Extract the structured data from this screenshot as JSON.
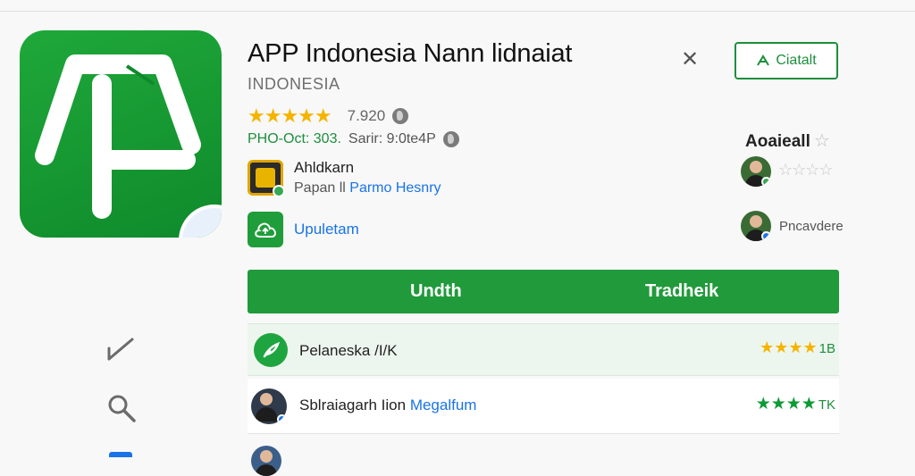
{
  "app": {
    "title": "APP Indonesia Nann lidnaiat",
    "subtitle": "INDONESIA",
    "rating_value": "7.920",
    "meta_prefix": "PHO-Oct: 303.",
    "meta_suffix": "Sarir: 9:0te4P",
    "brand_color": "#1e8e3e"
  },
  "developer": {
    "name": "Ahldkarn",
    "sub_prefix": "Papan ll",
    "sub_link": "Parmo Hesnry"
  },
  "update": {
    "label": "Upuletam"
  },
  "header_actions": {
    "close_icon": "close-icon",
    "install_label": "Ciatalt"
  },
  "accounts": {
    "title": "Aoaieall",
    "second_label": "Pncavdere"
  },
  "main_buttons": {
    "left_label": "Undth",
    "right_label": "Tradheik"
  },
  "list": [
    {
      "text": "Pelaneska /I/K",
      "link": "",
      "stars": "★★★★",
      "count": "1B",
      "icon": "leaf-icon"
    },
    {
      "text": "Sblraiagarh Iion ",
      "link": "Megalfum",
      "stars": "★★★★",
      "count": "TK",
      "icon": "avatar"
    }
  ],
  "sidebar": {
    "icons": [
      "checkmark-icon",
      "search-icon",
      "menu-icon"
    ]
  }
}
